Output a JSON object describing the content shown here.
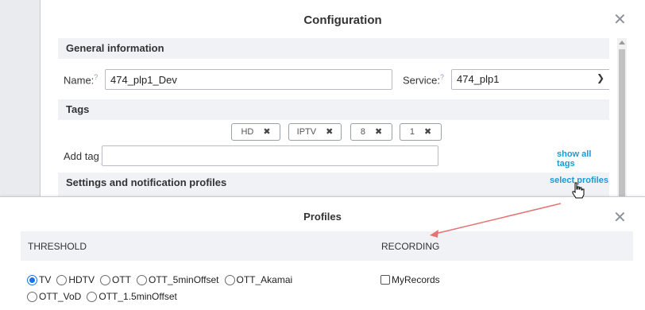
{
  "config": {
    "title": "Configuration",
    "sections": {
      "general": "General information",
      "tags": "Tags",
      "settings": "Settings and notification profiles"
    },
    "name_label": "Name:",
    "name_help": "?",
    "name_value": "474_plp1_Dev",
    "service_label": "Service:",
    "service_help": "?",
    "service_value": "474_plp1",
    "tags": [
      "HD",
      "IPTV",
      "8",
      "1"
    ],
    "add_tag_label": "Add tag",
    "show_all_tags": "show all tags",
    "select_profiles": "select profiles"
  },
  "profiles": {
    "title": "Profiles",
    "threshold_label": "THRESHOLD",
    "recording_label": "RECORDING",
    "threshold_options": [
      "TV",
      "HDTV",
      "OTT",
      "OTT_5minOffset",
      "OTT_Akamai",
      "OTT_VoD",
      "OTT_1.5minOffset"
    ],
    "threshold_selected": "TV",
    "recording_options": [
      "MyRecords"
    ]
  },
  "colors": {
    "accent_link": "#1a9ad6",
    "annotation_arrow": "#e57373",
    "header_bg": "#f0f2f5"
  },
  "icons": [
    "close-icon",
    "chevron-down-icon",
    "remove-tag-icon",
    "hand-pointer-icon"
  ]
}
